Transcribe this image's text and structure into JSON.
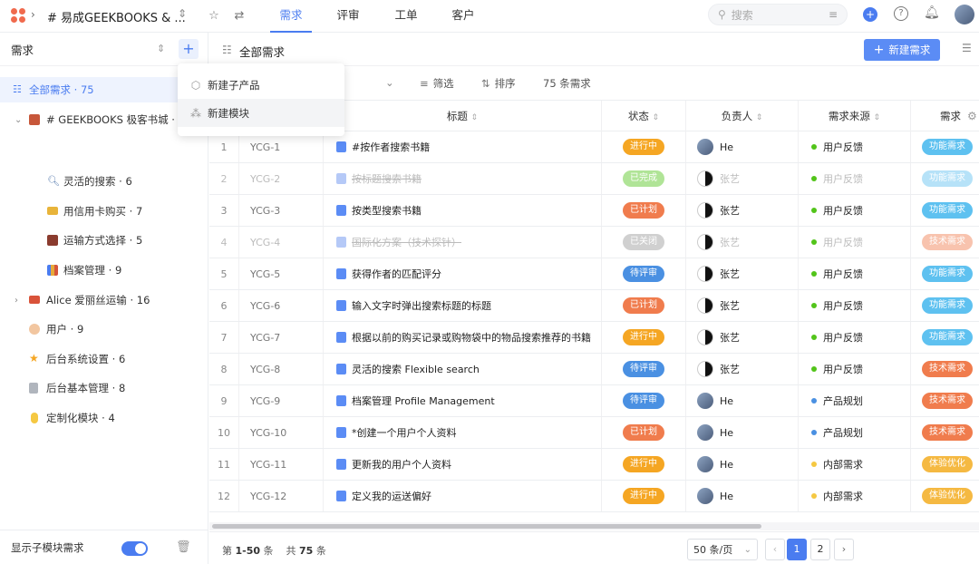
{
  "topbar": {
    "project_name": "# 易成GEEKBOOKS & ...",
    "tabs": [
      {
        "label": "需求",
        "active": true
      },
      {
        "label": "评审",
        "active": false
      },
      {
        "label": "工单",
        "active": false
      },
      {
        "label": "客户",
        "active": false
      }
    ],
    "search_placeholder": "搜索"
  },
  "sidebar": {
    "header": "需求",
    "items": [
      {
        "label": "全部需求 · 75",
        "icon": "list-icon",
        "selected": true
      },
      {
        "label": "# GEEKBOOKS 极客书城 · 32",
        "icon": "book-icon",
        "expanded": true
      },
      {
        "label": "灵活的搜索 · 6",
        "icon": "magnifier-icon"
      },
      {
        "label": "用信用卡购买 · 7",
        "icon": "credit-card-icon"
      },
      {
        "label": "运输方式选择 · 5",
        "icon": "train-icon"
      },
      {
        "label": "档案管理 · 9",
        "icon": "books-icon"
      },
      {
        "label": "Alice 爱丽丝运输 · 16",
        "icon": "truck-icon",
        "expanded": false
      },
      {
        "label": "用户 · 9",
        "icon": "person-icon"
      },
      {
        "label": "后台系统设置 · 6",
        "icon": "star-icon"
      },
      {
        "label": "后台基本管理 · 8",
        "icon": "speaker-icon"
      },
      {
        "label": "定制化模块 · 4",
        "icon": "bulb-icon"
      }
    ],
    "footer_label": "显示子模块需求",
    "show_submodules": true
  },
  "dropdown": {
    "items": [
      {
        "label": "新建子产品",
        "icon": "cube-icon"
      },
      {
        "label": "新建模块",
        "icon": "modules-icon"
      }
    ]
  },
  "main": {
    "title": "全部需求",
    "new_button": "新建需求",
    "toolbar": {
      "filter": "筛选",
      "sort": "排序",
      "count": "75 条需求"
    },
    "columns": [
      "标题",
      "状态",
      "负责人",
      "需求来源",
      "需求"
    ],
    "rows": [
      {
        "n": "1",
        "id": "YCG-1",
        "title": "#按作者搜索书籍",
        "status": "进行中",
        "status_color": "#f5a623",
        "owner": "He",
        "avatar": "photo",
        "source": "用户反馈",
        "source_color": "#52c41a",
        "type": "功能需求",
        "type_color": "#5ec1f0",
        "muted": false
      },
      {
        "n": "2",
        "id": "YCG-2",
        "title": "按标题搜索书籍",
        "status": "已完成",
        "status_color": "#52c41a",
        "owner": "张艺",
        "avatar": "bw",
        "source": "用户反馈",
        "source_color": "#52c41a",
        "type": "功能需求",
        "type_color": "#5ec1f0",
        "muted": true
      },
      {
        "n": "3",
        "id": "YCG-3",
        "title": "按类型搜索书籍",
        "status": "已计划",
        "status_color": "#f07c4d",
        "owner": "张艺",
        "avatar": "bw",
        "source": "用户反馈",
        "source_color": "#52c41a",
        "type": "功能需求",
        "type_color": "#5ec1f0",
        "muted": false
      },
      {
        "n": "4",
        "id": "YCG-4",
        "title": "国际化方案（技术探针）",
        "status": "已关闭",
        "status_color": "#999999",
        "owner": "张艺",
        "avatar": "bw",
        "source": "用户反馈",
        "source_color": "#52c41a",
        "type": "技术需求",
        "type_color": "#f07c4d",
        "muted": true
      },
      {
        "n": "5",
        "id": "YCG-5",
        "title": "获得作者的匹配评分",
        "status": "待评审",
        "status_color": "#4a90e2",
        "owner": "张艺",
        "avatar": "bw",
        "source": "用户反馈",
        "source_color": "#52c41a",
        "type": "功能需求",
        "type_color": "#5ec1f0",
        "muted": false
      },
      {
        "n": "6",
        "id": "YCG-6",
        "title": "输入文字时弹出搜索标题的标题",
        "status": "已计划",
        "status_color": "#f07c4d",
        "owner": "张艺",
        "avatar": "bw",
        "source": "用户反馈",
        "source_color": "#52c41a",
        "type": "功能需求",
        "type_color": "#5ec1f0",
        "muted": false
      },
      {
        "n": "7",
        "id": "YCG-7",
        "title": "根据以前的购买记录或购物袋中的物品搜索推荐的书籍",
        "status": "进行中",
        "status_color": "#f5a623",
        "owner": "张艺",
        "avatar": "bw",
        "source": "用户反馈",
        "source_color": "#52c41a",
        "type": "功能需求",
        "type_color": "#5ec1f0",
        "muted": false
      },
      {
        "n": "8",
        "id": "YCG-8",
        "title": "灵活的搜索 Flexible search",
        "status": "待评审",
        "status_color": "#4a90e2",
        "owner": "张艺",
        "avatar": "bw",
        "source": "用户反馈",
        "source_color": "#52c41a",
        "type": "技术需求",
        "type_color": "#f07c4d",
        "muted": false
      },
      {
        "n": "9",
        "id": "YCG-9",
        "title": "档案管理 Profile Management",
        "status": "待评审",
        "status_color": "#4a90e2",
        "owner": "He",
        "avatar": "photo",
        "source": "产品规划",
        "source_color": "#4a90e2",
        "type": "技术需求",
        "type_color": "#f07c4d",
        "muted": false
      },
      {
        "n": "10",
        "id": "YCG-10",
        "title": "*创建一个用户个人资料",
        "status": "已计划",
        "status_color": "#f07c4d",
        "owner": "He",
        "avatar": "photo",
        "source": "产品规划",
        "source_color": "#4a90e2",
        "type": "技术需求",
        "type_color": "#f07c4d",
        "muted": false
      },
      {
        "n": "11",
        "id": "YCG-11",
        "title": "更新我的用户个人资料",
        "status": "进行中",
        "status_color": "#f5a623",
        "owner": "He",
        "avatar": "photo",
        "source": "内部需求",
        "source_color": "#f5c842",
        "type": "体验优化",
        "type_color": "#f5b942",
        "muted": false
      },
      {
        "n": "12",
        "id": "YCG-12",
        "title": "定义我的运送偏好",
        "status": "进行中",
        "status_color": "#f5a623",
        "owner": "He",
        "avatar": "photo",
        "source": "内部需求",
        "source_color": "#f5c842",
        "type": "体验优化",
        "type_color": "#f5b942",
        "muted": false
      }
    ]
  },
  "footer": {
    "range_prefix": "第",
    "range": "1-50",
    "range_suffix": "条",
    "total_prefix": "共",
    "total": "75",
    "total_suffix": "条",
    "page_size": "50 条/页",
    "pages": [
      "1",
      "2"
    ],
    "current_page": "1"
  }
}
